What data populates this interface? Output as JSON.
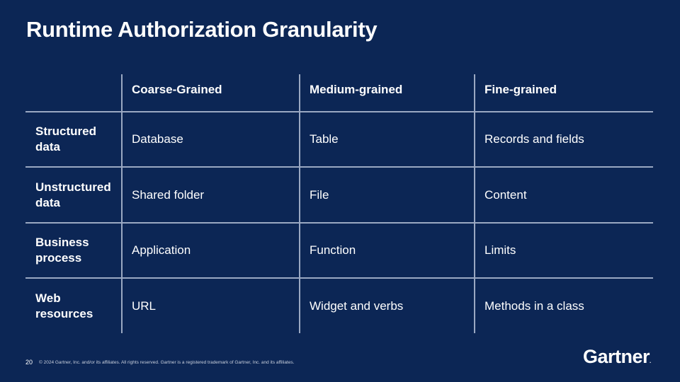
{
  "title": "Runtime Authorization Granularity",
  "table": {
    "columns": [
      "",
      "Coarse-Grained",
      "Medium-grained",
      "Fine-grained"
    ],
    "rows": [
      {
        "label": "Structured data",
        "cells": [
          "Database",
          "Table",
          "Records and fields"
        ]
      },
      {
        "label": "Unstructured data",
        "cells": [
          "Shared folder",
          "File",
          "Content"
        ]
      },
      {
        "label": "Business process",
        "cells": [
          "Application",
          "Function",
          "Limits"
        ]
      },
      {
        "label": "Web resources",
        "cells": [
          "URL",
          "Widget and verbs",
          "Methods in a class"
        ]
      }
    ]
  },
  "footer": {
    "page_number": "20",
    "copyright": "© 2024 Gartner, Inc. and/or its affiliates. All rights reserved. Gartner is a registered trademark of Gartner, Inc. and its affiliates."
  },
  "logo": {
    "text": "Gartner",
    "dot": "."
  },
  "colors": {
    "background": "#0c2655",
    "grid": "#9aa8c2",
    "text": "#ffffff"
  }
}
